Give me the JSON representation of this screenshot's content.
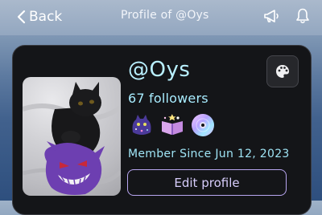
{
  "nav": {
    "back_label": "Back",
    "title": "Profile of @Oys"
  },
  "profile": {
    "username": "@Oys",
    "followers": "67 followers",
    "member_since": "Member Since Jun 12, 2023",
    "edit_label": "Edit profile",
    "badges": [
      "galaxy-cat-badge",
      "spellbook-badge",
      "disc-badge"
    ]
  },
  "colors": {
    "accent_cyan": "#b9f0ff",
    "accent_purple": "#b8a6f0",
    "card_bg": "#141518"
  }
}
